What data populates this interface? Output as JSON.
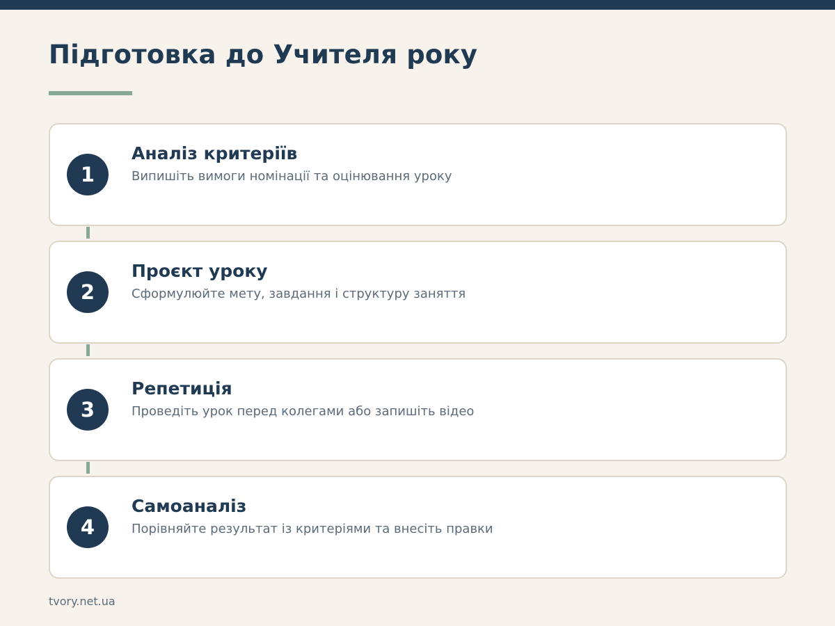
{
  "header": {
    "title": "Підготовка до Учителя року"
  },
  "steps": [
    {
      "number": "1",
      "title": "Аналіз критеріїв",
      "description": "Випишіть вимоги номінації та оцінювання уроку"
    },
    {
      "number": "2",
      "title": "Проєкт уроку",
      "description": "Сформулюйте мету, завдання і структуру заняття"
    },
    {
      "number": "3",
      "title": "Репетиція",
      "description": "Проведіть урок перед колегами або запишіть відео"
    },
    {
      "number": "4",
      "title": "Самоаналіз",
      "description": "Порівняйте результат із критеріями та внесіть правки"
    }
  ],
  "footer": {
    "source": "tvory.net.ua"
  },
  "colors": {
    "background": "#f7f3ec",
    "primary": "#1f3a52",
    "accent": "#86aa96",
    "card_border": "#ddd5c8",
    "muted_text": "#5c6b79"
  }
}
